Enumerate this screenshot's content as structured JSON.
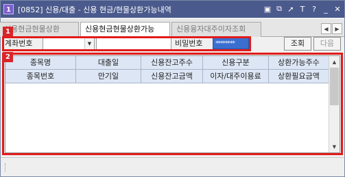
{
  "window": {
    "number": "1",
    "title": "[0852] 신용/대출 - 신용 현금/현물상환가능내역",
    "icons": [
      "restore-icon",
      "link-icon",
      "pin-icon",
      "text-size-icon",
      "help-icon",
      "minimize-icon",
      "close-icon"
    ],
    "icon_glyphs": {
      "restore": "▣",
      "link": "⧉",
      "pin": "➚",
      "font": "T",
      "help": "?",
      "minimize": "_",
      "close": "✕"
    }
  },
  "tabs": [
    {
      "label": "신용현금현물상환",
      "active": false
    },
    {
      "label": "신용현금현물상환가능",
      "active": true
    },
    {
      "label": "신용융자대주이자조회",
      "active": false
    }
  ],
  "tab_arrows": {
    "prev": "◀",
    "next": "▶"
  },
  "form": {
    "account_label": "계좌번호",
    "account_value": "",
    "account_name_value": "",
    "password_label": "비밀번호",
    "password_value": "********",
    "combo_arrow": "▼",
    "query_button": "조회",
    "next_button": "다음"
  },
  "markers": {
    "one": "1",
    "two": "2"
  },
  "grid": {
    "header_row1": [
      "종목명",
      "대출일",
      "신용잔고주수",
      "신용구분",
      "상환가능주수"
    ],
    "header_row2": [
      "종목번호",
      "만기일",
      "신용잔고금액",
      "이자/대주이용료",
      "상환필요금액"
    ],
    "scroll_up": "▲",
    "scroll_down": "▼",
    "rows": []
  },
  "colors": {
    "titlebar": "#4a5a8c",
    "highlight": "#e21a1a",
    "header_bg": "#dde6f4",
    "password_bg": "#3a6fd0"
  }
}
